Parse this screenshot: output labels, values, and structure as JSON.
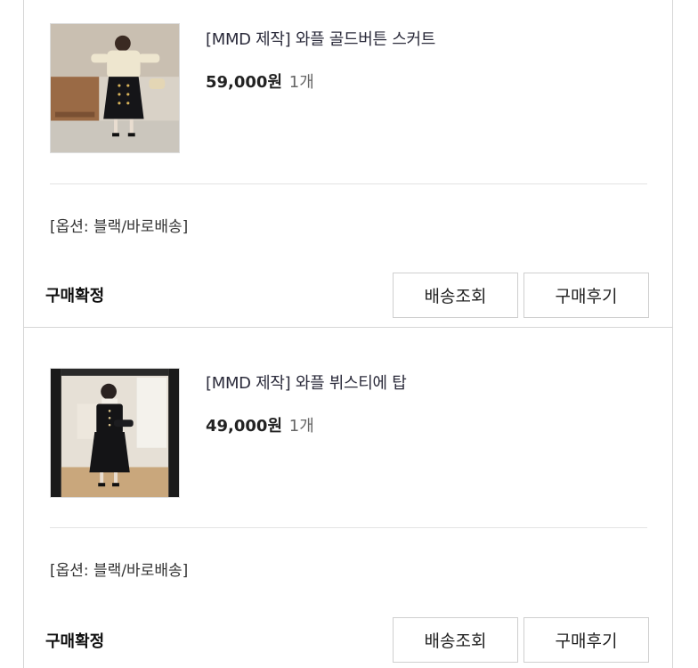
{
  "orders": [
    {
      "title": "[MMD 제작] 와플 골드버튼 스커트",
      "price": "59,000",
      "price_unit": "원",
      "quantity": "1개",
      "option": "[옵션: 블랙/바로배송]",
      "status": "구매확정",
      "buttons": {
        "shipping": "배송조회",
        "review": "구매후기"
      }
    },
    {
      "title": "[MMD 제작] 와플 뷔스티에 탑",
      "price": "49,000",
      "price_unit": "원",
      "quantity": "1개",
      "option": "[옵션: 블랙/바로배송]",
      "status": "구매확정",
      "buttons": {
        "shipping": "배송조회",
        "review": "구매후기"
      }
    }
  ],
  "colors": {
    "border": "#d6d6d6",
    "divider": "#e3e3e3",
    "title_text": "#2b2b3b",
    "quantity_text": "#666666"
  }
}
